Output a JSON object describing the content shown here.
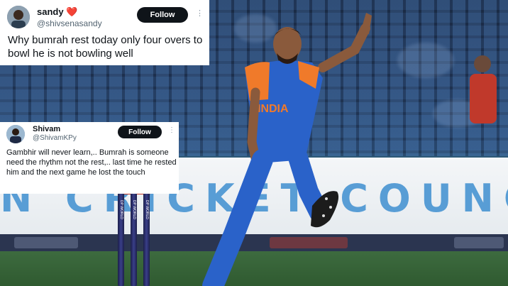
{
  "tweets": [
    {
      "name": "sandy",
      "emoji": "❤️",
      "handle": "@shivsenasandy",
      "follow_label": "Follow",
      "text": "Why bumrah rest today only four overs to bowl he is not bowling well"
    },
    {
      "name": "Shivam",
      "handle": "@ShivamKPy",
      "follow_label": "Follow",
      "text": "Gambhir will never learn,.. Bumrah is someone need the rhythm not the rest,.. last time he rested him and the next game he lost the touch"
    }
  ],
  "scene": {
    "board_text": "N CRICKET COUNCIL",
    "jersey_text": "INDIA",
    "stump_text": "DP WORLD",
    "colors": {
      "jersey_blue": "#2a62c9",
      "jersey_orange": "#f07a2a",
      "board_text": "#3f8fd0",
      "follow_button": "#0f1419",
      "heart": "#e0245e"
    }
  }
}
